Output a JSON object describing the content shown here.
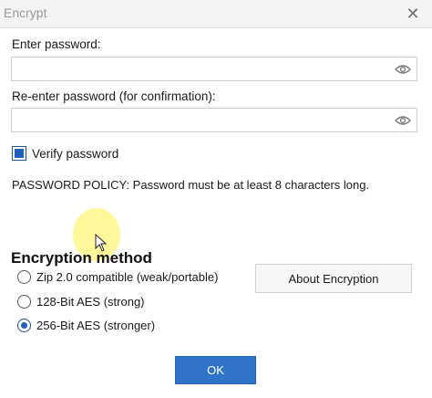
{
  "window": {
    "title": "Encrypt"
  },
  "password": {
    "label": "Enter password:",
    "value": "",
    "confirm_label": "Re-enter password (for confirmation):",
    "confirm_value": ""
  },
  "verify": {
    "label": "Verify password",
    "checked": true
  },
  "policy": {
    "text": "PASSWORD POLICY: Password must be at least 8 characters long."
  },
  "encryption": {
    "heading": "Encryption method",
    "options": [
      {
        "label": "Zip 2.0 compatible (weak/portable)",
        "selected": false
      },
      {
        "label": "128-Bit AES (strong)",
        "selected": false
      },
      {
        "label": "256-Bit AES (stronger)",
        "selected": true
      }
    ],
    "about_label": "About Encryption"
  },
  "footer": {
    "ok_label": "OK"
  },
  "icons": {
    "close": "close-icon",
    "eye": "eye-icon",
    "cursor": "mouse-cursor-icon"
  },
  "colors": {
    "accent": "#2f74c8",
    "check_fill": "#1f5fbf",
    "highlight": "#fff578"
  }
}
